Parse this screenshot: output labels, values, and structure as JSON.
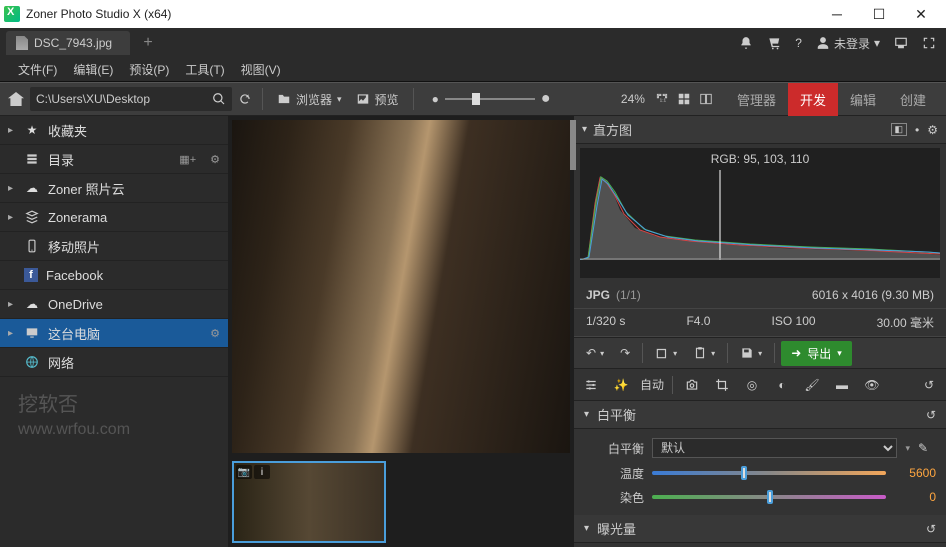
{
  "window": {
    "title": "Zoner Photo Studio X (x64)"
  },
  "tab": {
    "filename": "DSC_7943.jpg"
  },
  "tabbar_right": {
    "login": "未登录",
    "login_caret": "▾"
  },
  "menu": {
    "file": "文件(F)",
    "edit": "编辑(E)",
    "presets": "预设(P)",
    "tools": "工具(T)",
    "view": "视图(V)"
  },
  "toolbar": {
    "path": "C:\\Users\\XU\\Desktop",
    "browser": "浏览器",
    "browser_caret": "▾",
    "preview": "预览",
    "zoom_pct": "24%",
    "modes": {
      "manager": "管理器",
      "develop": "开发",
      "edit": "编辑",
      "create": "创建"
    }
  },
  "sidebar": {
    "items": [
      {
        "label": "收藏夹",
        "icon": "star",
        "caret": "▸",
        "extra": ""
      },
      {
        "label": "目录",
        "icon": "catalog",
        "caret": "",
        "extra_icons": true
      },
      {
        "label": "Zoner 照片云",
        "icon": "cloud",
        "caret": "▸",
        "extra": ""
      },
      {
        "label": "Zonerama",
        "icon": "zonerama",
        "caret": "▸",
        "extra": ""
      },
      {
        "label": "移动照片",
        "icon": "mobile",
        "caret": "",
        "extra": ""
      },
      {
        "label": "Facebook",
        "icon": "facebook",
        "caret": "",
        "extra": ""
      },
      {
        "label": "OneDrive",
        "icon": "onedrive",
        "caret": "▸",
        "extra": ""
      },
      {
        "label": "这台电脑",
        "icon": "computer",
        "caret": "▸",
        "selected": true,
        "gear": true
      },
      {
        "label": "网络",
        "icon": "network",
        "caret": "",
        "extra": ""
      }
    ]
  },
  "watermark": {
    "line1": "挖软否",
    "line2": "www.wrfou.com"
  },
  "histogram": {
    "title": "直方图",
    "rgb_label": "RGB: 95, 103, 110"
  },
  "meta": {
    "format": "JPG",
    "index": "(1/1)",
    "dimensions": "6016 x 4016 (9.30 MB)",
    "shutter": "1/320 s",
    "aperture": "F4.0",
    "iso": "ISO 100",
    "focal": "30.00 毫米"
  },
  "actions": {
    "export": "导出",
    "auto": "自动"
  },
  "wb": {
    "section": "白平衡",
    "label": "白平衡",
    "preset": "默认",
    "temp_label": "温度",
    "temp_value": "5600",
    "tint_label": "染色",
    "tint_value": "0"
  },
  "exposure": {
    "section": "曝光量"
  },
  "chart_data": {
    "type": "area",
    "title": "直方图",
    "xlabel": "",
    "ylabel": "",
    "xlim": [
      0,
      255
    ],
    "series": [
      {
        "name": "R",
        "color": "#d94444"
      },
      {
        "name": "G",
        "color": "#4caf50"
      },
      {
        "name": "B",
        "color": "#4a9edb"
      },
      {
        "name": "L",
        "color": "#cccccc"
      }
    ],
    "note": "Image histogram — peak near shadows (~20), long low tail across midtones; RGB sample at cursor: 95,103,110"
  }
}
